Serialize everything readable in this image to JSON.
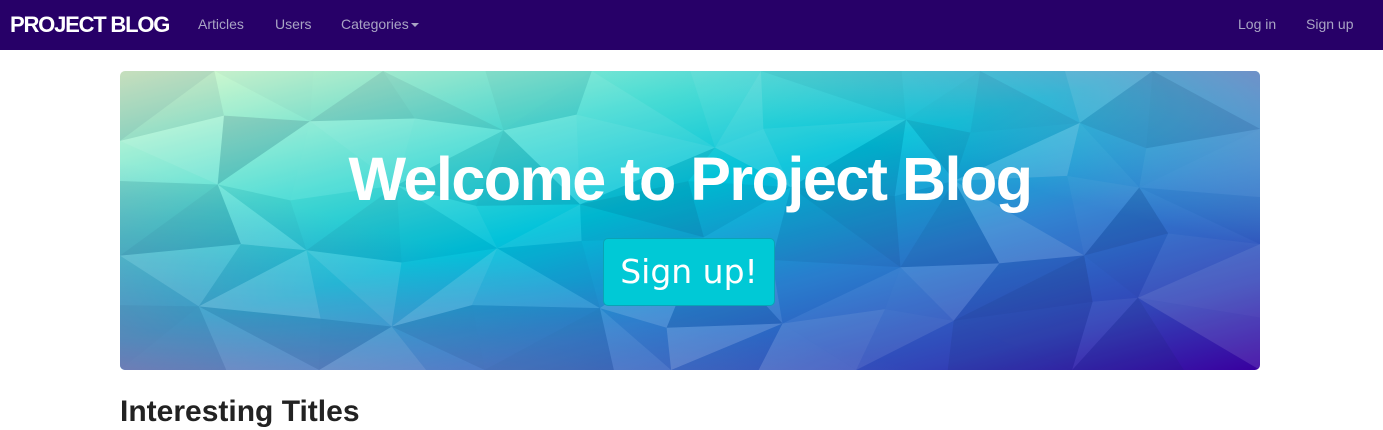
{
  "navbar": {
    "brand": "PROJECT BLOG",
    "links": {
      "articles": "Articles",
      "users": "Users",
      "categories": "Categories"
    },
    "right": {
      "login": "Log in",
      "signup": "Sign up"
    },
    "colors": {
      "background": "#270068",
      "link": "#a9a4c4"
    }
  },
  "hero": {
    "title": "Welcome to Project Blog",
    "button_label": "Sign up!",
    "colors": {
      "button": "#00c9d6",
      "gradient": [
        "#e6ffd0",
        "#00c8d8",
        "#2a6fc0",
        "#3a00a0"
      ]
    }
  },
  "section": {
    "title": "Interesting Titles"
  }
}
